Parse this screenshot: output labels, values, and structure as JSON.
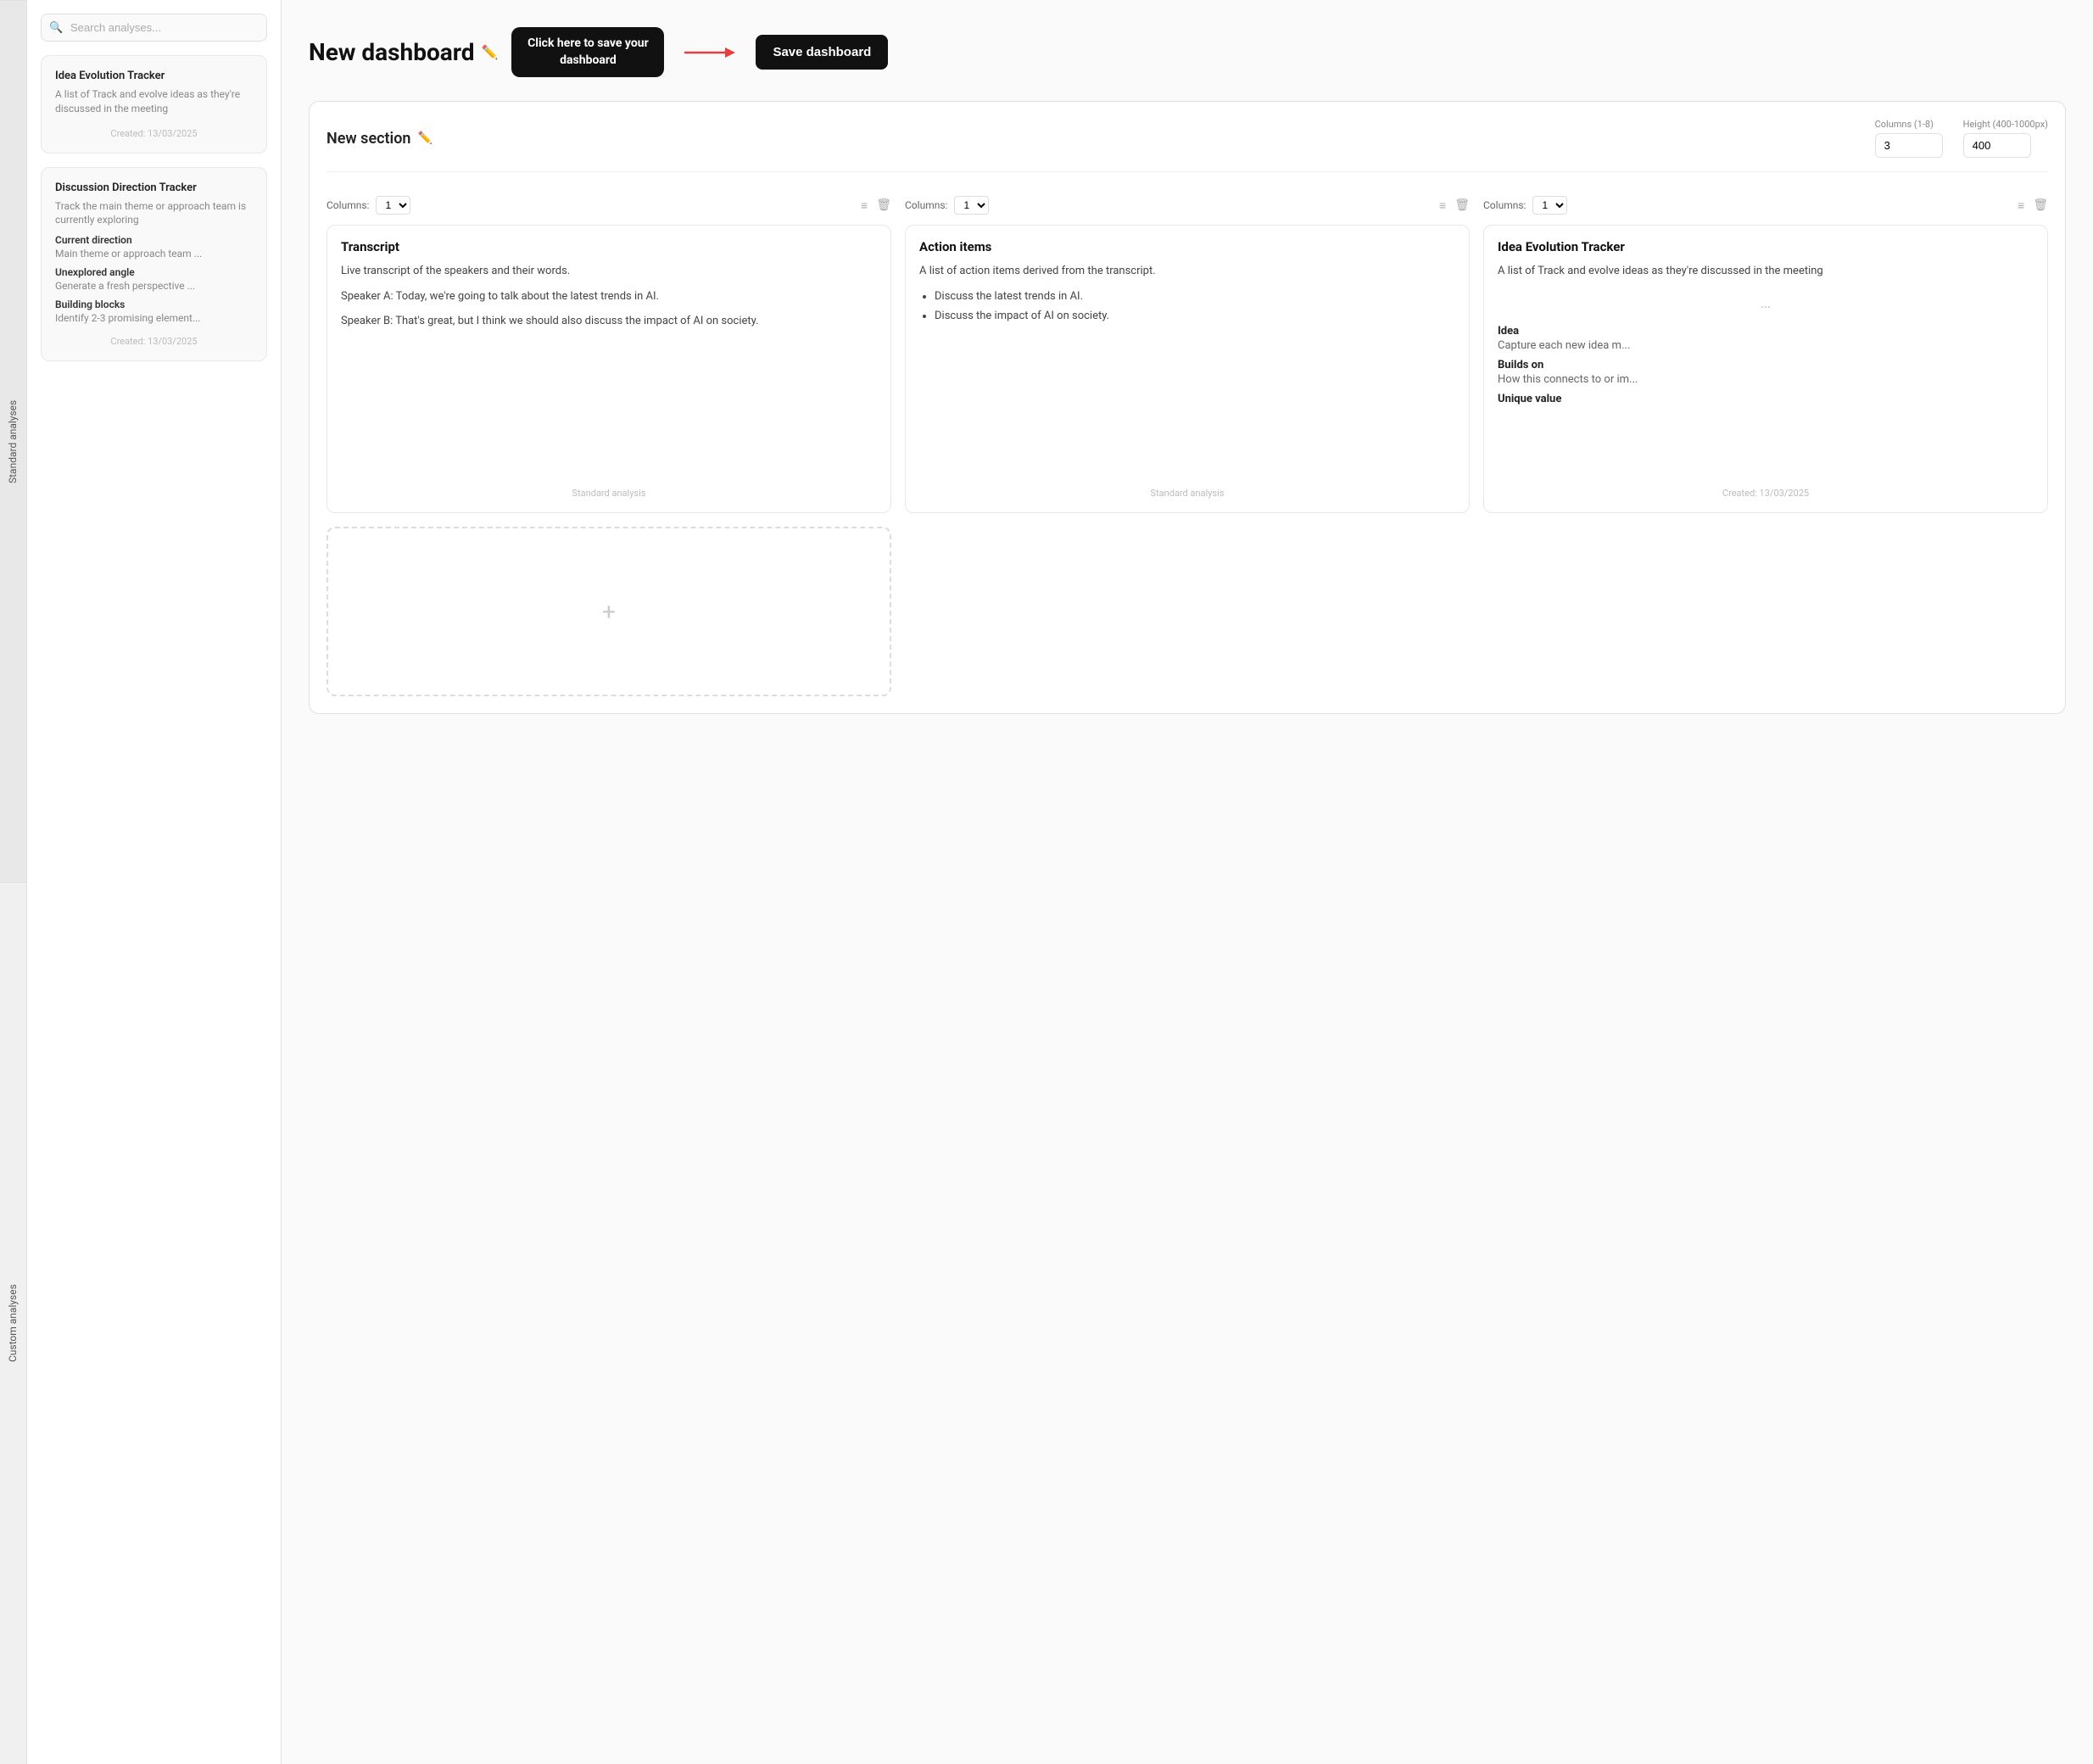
{
  "sidebar": {
    "tabs": [
      {
        "id": "standard",
        "label": "Standard analyses"
      },
      {
        "id": "custom",
        "label": "Custom analyses"
      }
    ]
  },
  "search": {
    "placeholder": "Search analyses..."
  },
  "standard_card": {
    "title": "Idea Evolution Tracker",
    "description": "A list of Track and evolve ideas as they're discussed in the meeting",
    "date": "Created: 13/03/2025"
  },
  "custom_card": {
    "title": "Discussion Direction Tracker",
    "description": "Track the main theme or approach team is currently exploring",
    "fields": [
      {
        "label": "Current direction",
        "value": "Main theme or approach team ..."
      },
      {
        "label": "Unexplored angle",
        "value": "Generate a fresh perspective ..."
      },
      {
        "label": "Building blocks",
        "value": "Identify 2-3 promising element..."
      }
    ],
    "date": "Created: 13/03/2025"
  },
  "header": {
    "title": "New dashboard",
    "tooltip": "Click here to save your dashboard",
    "save_button": "Save dashboard"
  },
  "section": {
    "title": "New section",
    "columns_label": "Columns (1-8)",
    "columns_value": "3",
    "height_label": "Height (400-1000px)",
    "height_value": "400"
  },
  "widgets": [
    {
      "columns_label": "Columns:",
      "columns_value": "1",
      "title": "Transcript",
      "type": "Standard analysis",
      "content": [
        {
          "type": "text",
          "value": "Live transcript of the speakers and their words."
        },
        {
          "type": "text",
          "value": "Speaker A: Today, we're going to talk about the latest trends in AI."
        },
        {
          "type": "text",
          "value": "Speaker B: That's great, but I think we should also discuss the impact of AI on society."
        }
      ]
    },
    {
      "columns_label": "Columns:",
      "columns_value": "1",
      "title": "Action items",
      "type": "Standard analysis",
      "content": [
        {
          "type": "text",
          "value": "A list of action items derived from the transcript."
        },
        {
          "type": "list",
          "items": [
            "Discuss the latest trends in AI.",
            "Discuss the impact of AI on society."
          ]
        }
      ]
    },
    {
      "columns_label": "Columns:",
      "columns_value": "1",
      "title": "Idea Evolution Tracker",
      "type": "Custom analysis",
      "description": "A list of Track and evolve ideas as they're discussed in the meeting",
      "fields": [
        {
          "label": "Idea",
          "value": "Capture each new idea m..."
        },
        {
          "label": "Builds on",
          "value": "How this connects to or im..."
        },
        {
          "label": "Unique value",
          "value": ""
        }
      ],
      "date": "Created: 13/03/2025"
    }
  ],
  "add_widget": {
    "icon": "+"
  }
}
